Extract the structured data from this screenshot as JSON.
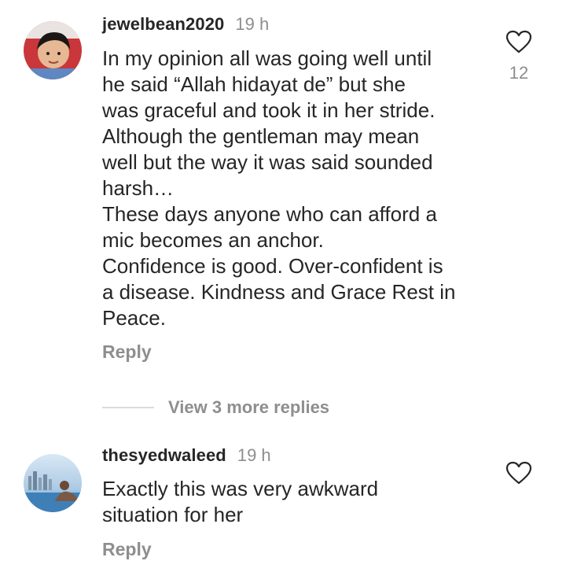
{
  "comments": [
    {
      "username": "jewelbean2020",
      "time": "19 h",
      "text": "In my opinion all was going well until\nhe said “Allah hidayat de” but she\nwas graceful and took it in her stride.\nAlthough the gentleman may mean\nwell but the way it was said sounded\nharsh…\nThese days anyone who can afford a\nmic becomes an anchor.\nConfidence is good. Over-confident is\na disease. Kindness and Grace Rest in\nPeace.",
      "reply_label": "Reply",
      "like_icon": "heart-outline-icon",
      "like_count": "12"
    },
    {
      "username": "thesyedwaleed",
      "time": "19 h",
      "text": "Exactly this was very awkward\nsituation for her",
      "reply_label": "Reply",
      "like_icon": "heart-outline-icon"
    }
  ],
  "view_more_replies": "View 3 more replies",
  "colors": {
    "text_primary": "#262626",
    "text_secondary": "#8e8e8e",
    "divider": "#dbdbdb"
  }
}
